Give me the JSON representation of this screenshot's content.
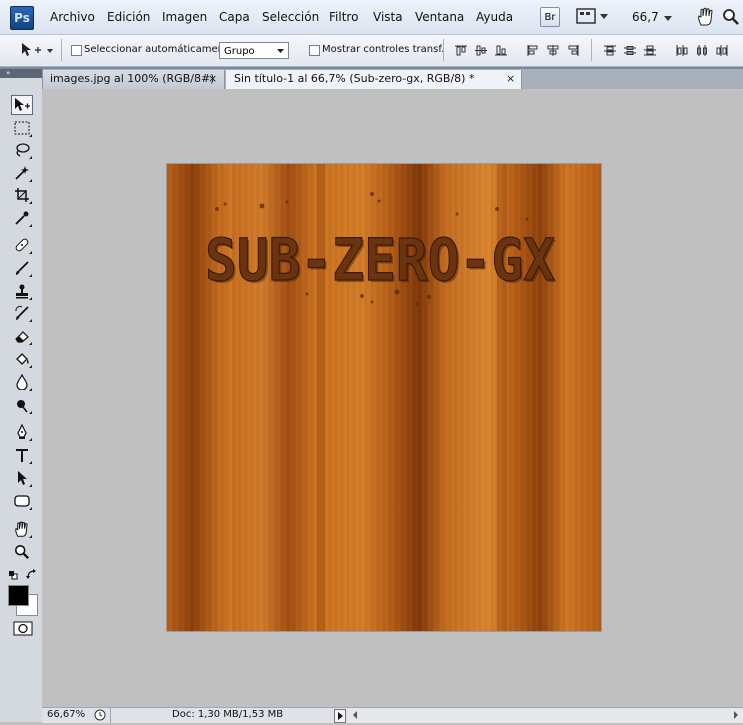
{
  "app": {
    "logo_text": "Ps"
  },
  "menu": {
    "items": [
      "Archivo",
      "Edición",
      "Imagen",
      "Capa",
      "Selección",
      "Filtro",
      "Vista",
      "Ventana",
      "Ayuda"
    ],
    "bridge_label": "Br",
    "zoom_value": "66,7"
  },
  "options": {
    "auto_select_label": "Seleccionar automáticamente:",
    "auto_select_value": "Grupo",
    "show_transform_label": "Mostrar controles transf."
  },
  "tabs": [
    {
      "label": "images.jpg al 100% (RGB/8#)",
      "close": "×"
    },
    {
      "label": "Sin título-1 al 66,7% (Sub-zero-gx, RGB/8) *",
      "close": "×"
    }
  ],
  "tools": [
    "move-tool",
    "marquee-tool",
    "lasso-tool",
    "magic-wand-tool",
    "crop-tool",
    "eyedropper-tool",
    "healing-brush-tool",
    "brush-tool",
    "clone-stamp-tool",
    "history-brush-tool",
    "eraser-tool",
    "paint-bucket-tool",
    "blur-tool",
    "dodge-tool",
    "pen-tool",
    "type-tool",
    "path-selection-tool",
    "shape-tool",
    "hand-tool",
    "zoom-tool"
  ],
  "colors": {
    "foreground": "#000000",
    "background": "#ffffff",
    "wood_dark": "#8a3f0c",
    "wood_light": "#c9701f"
  },
  "document": {
    "text": "SUB-ZERO-GX"
  },
  "status": {
    "zoom": "66,67%",
    "doc_info": "Doc: 1,30 MB/1,53 MB"
  }
}
